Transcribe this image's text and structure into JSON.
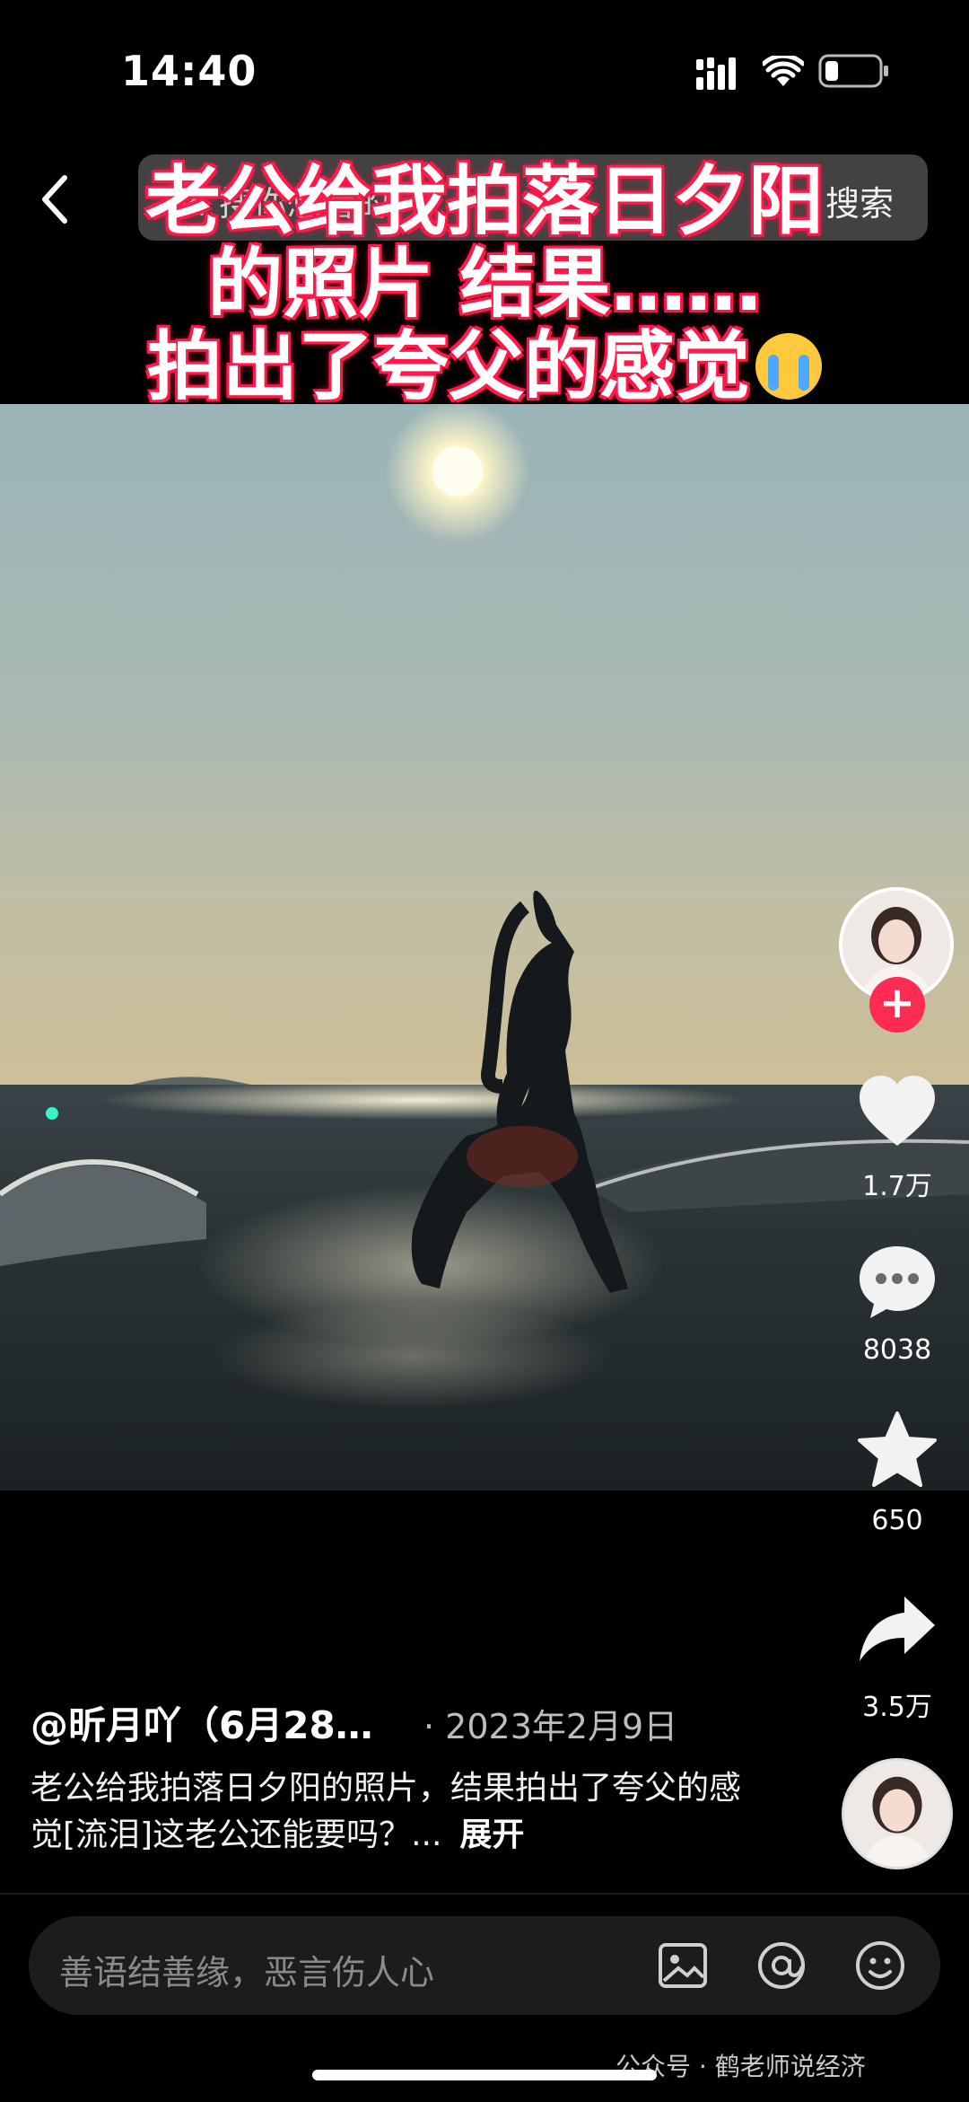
{
  "status_bar": {
    "time": "14:40"
  },
  "search": {
    "placeholder": "搜你想看的",
    "button_label": "搜索"
  },
  "overlay_caption": {
    "line1": "老公给我拍落日夕阳",
    "line2": "的照片 结果……",
    "line3": "拍出了夸父的感觉",
    "emoji": "crying-face"
  },
  "actions": {
    "likes": "1.7万",
    "comments": "8038",
    "favorites": "650",
    "shares": "3.5万"
  },
  "post": {
    "author": "@昕月吖（6月28…",
    "date": "· 2023年2月9日",
    "description": "老公给我拍落日夕阳的照片，结果拍出了夸父的感觉[流泪]这老公还能要吗？...",
    "expand_label": "展开"
  },
  "comment_bar": {
    "placeholder": "善语结善缘，恶言伤人心"
  },
  "watermark": "公众号 · 鹤老师说经济",
  "icons": [
    "back-icon",
    "search-icon",
    "heart-icon",
    "comment-icon",
    "star-icon",
    "share-icon",
    "image-icon",
    "at-icon",
    "emoji-icon"
  ],
  "colors": {
    "accent": "#fe2c55",
    "caption_glow": "#ff1a4a"
  }
}
